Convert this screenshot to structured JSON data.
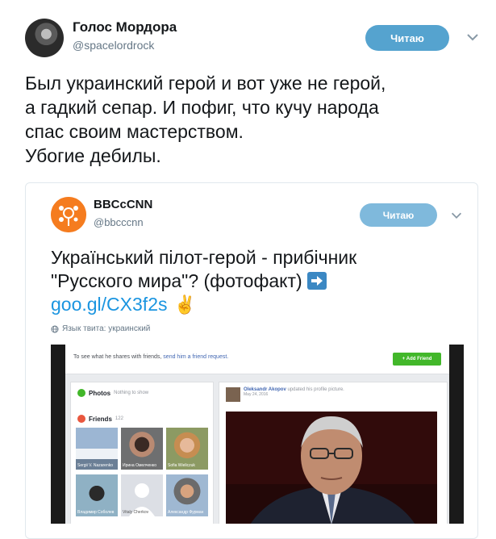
{
  "tweet": {
    "author_name": "Голос Мордора",
    "author_handle": "@spacelordrock",
    "follow_label": "Читаю",
    "lines": [
      "Был украинский герой и вот уже не герой,",
      "а гадкий сепар. И пофиг, что кучу народа",
      "спас своим мастерством.",
      "Убогие дебилы."
    ]
  },
  "quoted": {
    "author_name": "BBCcCNN",
    "author_handle": "@bbcccnn",
    "follow_label": "Читаю",
    "line1": "Український пілот-герой - прибічник",
    "line2": "\"Русского мира\"? (фотофакт)",
    "link": "goo.gl/CX3f2s",
    "language_note": "Язык твита: украинский"
  },
  "screenshot": {
    "bar_text": "To see what he shares with friends,",
    "bar_link": "send him a friend request.",
    "add_friend": "Add Friend",
    "photos_label": "Photos",
    "photos_sub": "Nothing to show",
    "friends_label": "Friends",
    "friends_count": "122",
    "friends": [
      "Sergii V. Nazarenko",
      "Ирина Омелченко",
      "Sofia Wieliczuk",
      "Владимир Соболев",
      "Vitaly Cherkov",
      "Александр Фурман"
    ],
    "post_author": "Oleksandr Akopov",
    "post_action": "updated his profile picture.",
    "post_date": "May 24, 2016"
  },
  "colors": {
    "follow_button": "#55a3cf",
    "link": "#1b95e0",
    "fb_green": "#42b72a"
  },
  "icons": [
    "chevron-down-icon",
    "arrow-right-icon",
    "victory-hand-icon",
    "globe-icon"
  ]
}
